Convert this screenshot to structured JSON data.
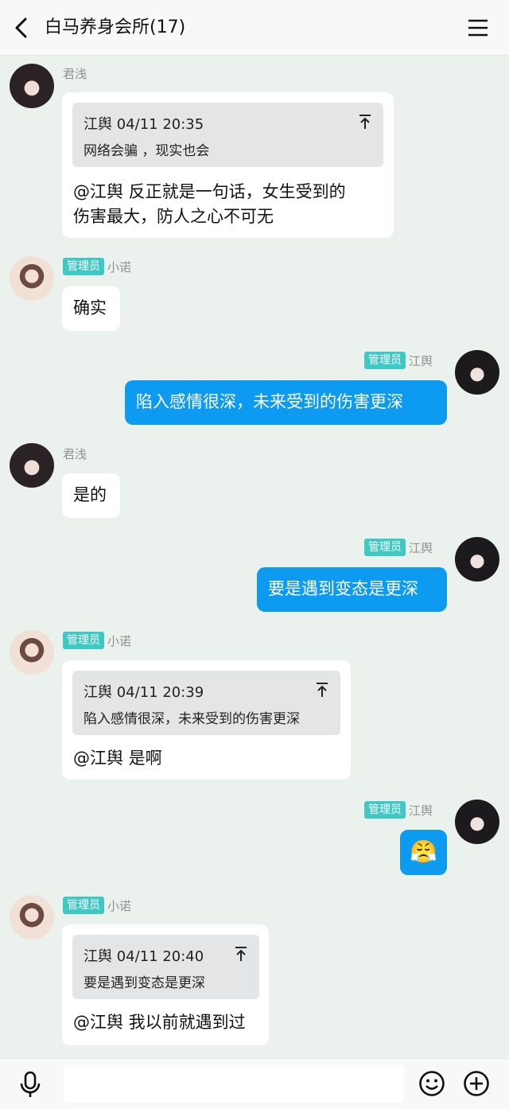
{
  "header": {
    "title": "白马养身会所(17)",
    "back_icon": "chevron-left-icon",
    "menu_icon": "menu-icon"
  },
  "messages": [
    {
      "sender": "君浅",
      "quote": {
        "head": "江舆 04/11 20:35",
        "text": "网络会骗 ，现实也会"
      },
      "lines": [
        "@江舆 反正就是一句话，女生受到的",
        "伤害最大，防人之心不可无"
      ]
    },
    {
      "badge": "管理员",
      "sender": "小诺",
      "text": "确实"
    },
    {
      "badge": "管理员",
      "sender": "江舆",
      "text": "陷入感情很深，未来受到的伤害更深"
    },
    {
      "sender": "君浅",
      "text": "是的"
    },
    {
      "badge": "管理员",
      "sender": "江舆",
      "text": "要是遇到变态是更深"
    },
    {
      "badge": "管理员",
      "sender": "小诺",
      "quote": {
        "head": "江舆 04/11 20:39",
        "text": "陷入感情很深，未来受到的伤害更深"
      },
      "text": "@江舆 是啊"
    },
    {
      "badge": "管理员",
      "sender": "江舆",
      "emoji": "😤"
    },
    {
      "badge": "管理员",
      "sender": "小诺",
      "quote": {
        "head": "江舆 04/11 20:40",
        "text": "要是遇到变态是更深"
      },
      "text": "@江舆 我以前就遇到过"
    }
  ],
  "bottom_bar": {
    "mic_icon": "microphone-icon",
    "emoji_icon": "smiley-icon",
    "add_icon": "plus-icon",
    "input_placeholder": ""
  },
  "colors": {
    "background": "#ebf1ec",
    "my_bubble": "#0d9bf2",
    "admin_badge": "#3fc9c4"
  }
}
